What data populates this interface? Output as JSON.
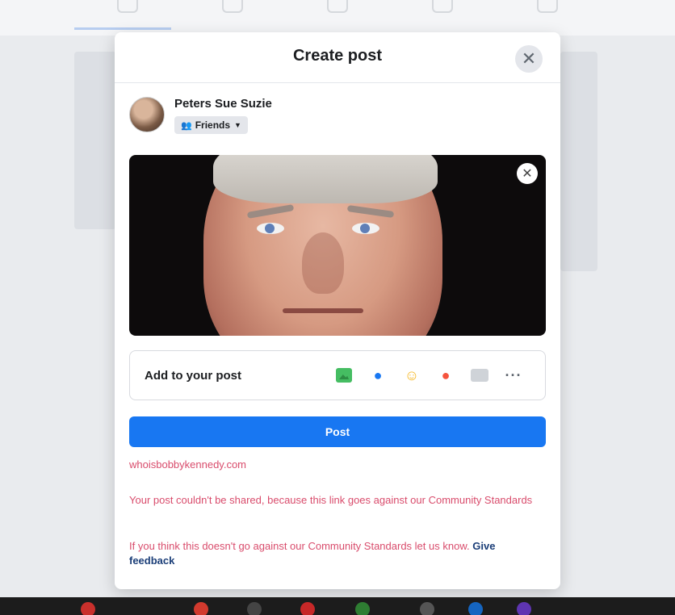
{
  "dialog": {
    "title": "Create post"
  },
  "author": {
    "name": "Peters Sue Suzie",
    "audience": "Friends"
  },
  "add_to_post": {
    "label": "Add to your post",
    "icons": [
      "photo-video-icon",
      "tag-people-icon",
      "feeling-icon",
      "check-in-icon",
      "gif-icon",
      "more-icon"
    ]
  },
  "post_button": {
    "label": "Post"
  },
  "errors": {
    "link": "whoisbobbykennedy.com",
    "message": "Your post couldn't be shared, because this link goes against our Community Standards",
    "appeal_prefix": "If you think this doesn't go against our Community Standards let us know.",
    "appeal_link": "Give feedback"
  },
  "colors": {
    "primary": "#1877f2",
    "error": "#d94c6c",
    "feedback_link": "#1b3e78"
  }
}
